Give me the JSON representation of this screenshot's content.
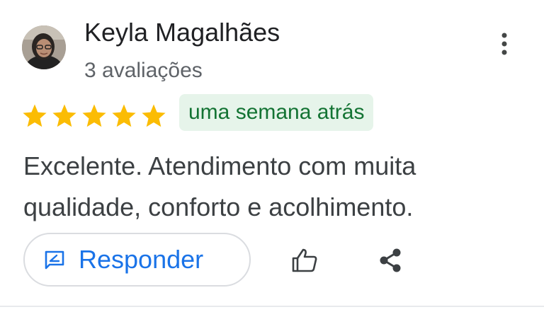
{
  "review": {
    "author_name": "Keyla Magalhães",
    "review_count": "3 avaliações",
    "rating": 5,
    "rating_max": 5,
    "time_ago": "uma semana atrás",
    "text": "Excelente. Atendimento com muita qualidade, conforto e acolhimento."
  },
  "actions": {
    "reply_label": "Responder",
    "icons": {
      "more": "more-vert-icon",
      "reply": "reply-message-icon",
      "like": "thumb-up-icon",
      "share": "share-icon"
    }
  },
  "colors": {
    "star": "#fbbc04",
    "badge_bg": "#e6f4ea",
    "badge_text": "#137333",
    "accent": "#1a73e8",
    "text_primary": "#202124",
    "text_secondary": "#5f6368"
  }
}
